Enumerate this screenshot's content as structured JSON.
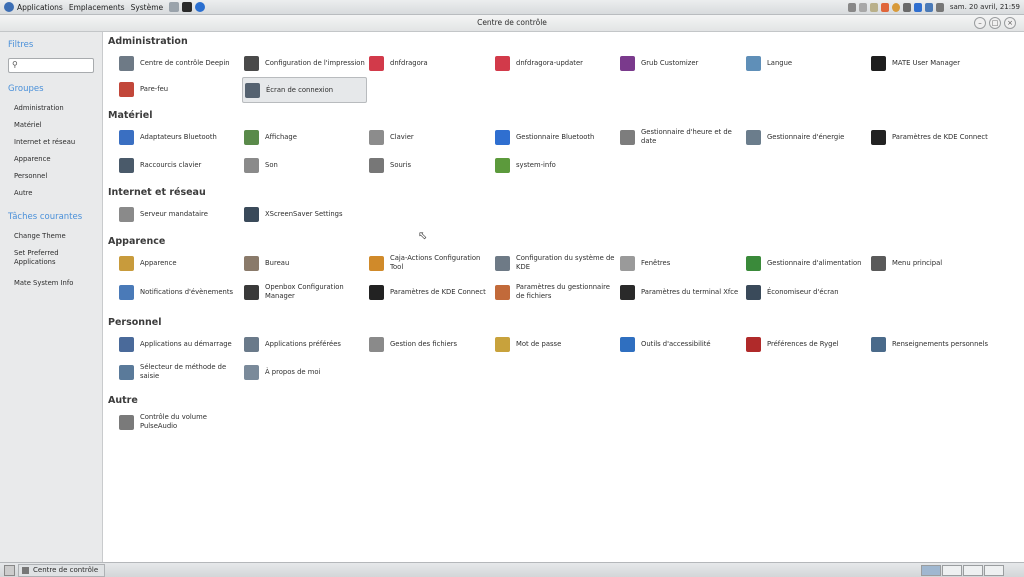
{
  "top_panel": {
    "menus": [
      "Applications",
      "Emplacements",
      "Système"
    ],
    "clock": "sam. 20 avril, 21:59"
  },
  "window": {
    "title": "Centre de contrôle"
  },
  "sidebar": {
    "filters_title": "Filtres",
    "search_value": "",
    "groups_title": "Groupes",
    "groups": [
      "Administration",
      "Matériel",
      "Internet et réseau",
      "Apparence",
      "Personnel",
      "Autre"
    ],
    "tasks_title": "Tâches courantes",
    "tasks": [
      "Change Theme",
      "Set Preferred Applications",
      "Mate System Info"
    ]
  },
  "sections": [
    {
      "title": "Administration",
      "items": [
        {
          "label": "Centre de contrôle Deepin",
          "icon": "tools-icon",
          "color": "#6e7a86"
        },
        {
          "label": "Configuration de l'impression",
          "icon": "printer-icon",
          "color": "#4a4a4a"
        },
        {
          "label": "dnfdragora",
          "icon": "dnfdragora-icon",
          "color": "#d23a4a"
        },
        {
          "label": "dnfdragora-updater",
          "icon": "dnfdragora-icon",
          "color": "#d23a4a"
        },
        {
          "label": "Grub Customizer",
          "icon": "grub-icon",
          "color": "#7a3a8c"
        },
        {
          "label": "Langue",
          "icon": "flag-icon",
          "color": "#5f8fb8"
        },
        {
          "label": "MATE User Manager",
          "icon": "users-icon",
          "color": "#1e1e1e"
        },
        {
          "label": "Pare-feu",
          "icon": "firewall-icon",
          "color": "#c2473a"
        },
        {
          "label": "Écran de connexion",
          "icon": "login-screen-icon",
          "color": "#556270",
          "selected": true
        }
      ]
    },
    {
      "title": "Matériel",
      "items": [
        {
          "label": "Adaptateurs Bluetooth",
          "icon": "bluetooth-adapter-icon",
          "color": "#3a6fc2"
        },
        {
          "label": "Affichage",
          "icon": "display-icon",
          "color": "#5a8a4a"
        },
        {
          "label": "Clavier",
          "icon": "keyboard-icon",
          "color": "#8c8c8c"
        },
        {
          "label": "Gestionnaire Bluetooth",
          "icon": "bluetooth-icon",
          "color": "#2f6fd0"
        },
        {
          "label": "Gestionnaire d'heure et de date",
          "icon": "clock-icon",
          "color": "#7d7d7d"
        },
        {
          "label": "Gestionnaire d'énergie",
          "icon": "power-icon",
          "color": "#6b7d8c"
        },
        {
          "label": "Paramètres de KDE Connect",
          "icon": "phone-icon",
          "color": "#222222"
        },
        {
          "label": "Raccourcis clavier",
          "icon": "keyboard-shortcuts-icon",
          "color": "#4a5a6a"
        },
        {
          "label": "Son",
          "icon": "speaker-icon",
          "color": "#8a8a8a"
        },
        {
          "label": "Souris",
          "icon": "mouse-icon",
          "color": "#777777"
        },
        {
          "label": "system-info",
          "icon": "system-info-icon",
          "color": "#5c9a3c"
        }
      ]
    },
    {
      "title": "Internet et réseau",
      "items": [
        {
          "label": "Serveur mandataire",
          "icon": "proxy-icon",
          "color": "#8a8a8a"
        },
        {
          "label": "XScreenSaver Settings",
          "icon": "screensaver-icon",
          "color": "#3a4a5a"
        }
      ]
    },
    {
      "title": "Apparence",
      "items": [
        {
          "label": "Apparence",
          "icon": "appearance-icon",
          "color": "#c89b3c"
        },
        {
          "label": "Bureau",
          "icon": "desktop-icon",
          "color": "#8a7a6a"
        },
        {
          "label": "Caja-Actions Configuration Tool",
          "icon": "caja-actions-icon",
          "color": "#d08a2a"
        },
        {
          "label": "Configuration du système de KDE",
          "icon": "kde-config-icon",
          "color": "#6e7a86"
        },
        {
          "label": "Fenêtres",
          "icon": "windows-icon",
          "color": "#9a9a9a"
        },
        {
          "label": "Gestionnaire d'alimentation",
          "icon": "battery-icon",
          "color": "#3a8a3a"
        },
        {
          "label": "Menu principal",
          "icon": "menu-icon",
          "color": "#5a5a5a"
        },
        {
          "label": "Notifications d'évènements",
          "icon": "notification-icon",
          "color": "#4a7ab8"
        },
        {
          "label": "Openbox Configuration Manager",
          "icon": "openbox-icon",
          "color": "#3a3a3a"
        },
        {
          "label": "Paramètres de KDE Connect",
          "icon": "phone-icon",
          "color": "#222222"
        },
        {
          "label": "Paramètres du gestionnaire de fichiers",
          "icon": "file-manager-settings-icon",
          "color": "#c26a3a"
        },
        {
          "label": "Paramètres du terminal Xfce",
          "icon": "terminal-icon",
          "color": "#2a2a2a"
        },
        {
          "label": "Économiseur d'écran",
          "icon": "screensaver-icon",
          "color": "#3a4a5a"
        }
      ]
    },
    {
      "title": "Personnel",
      "items": [
        {
          "label": "Applications au démarrage",
          "icon": "startup-icon",
          "color": "#4a6a9a"
        },
        {
          "label": "Applications préférées",
          "icon": "preferred-apps-icon",
          "color": "#6a7a8a"
        },
        {
          "label": "Gestion des fichiers",
          "icon": "file-management-icon",
          "color": "#8a8a8a"
        },
        {
          "label": "Mot de passe",
          "icon": "lock-icon",
          "color": "#c8a23c"
        },
        {
          "label": "Outils d'accessibilité",
          "icon": "accessibility-icon",
          "color": "#2f6fc0"
        },
        {
          "label": "Préférences de Rygel",
          "icon": "rygel-icon",
          "color": "#b02a2a"
        },
        {
          "label": "Renseignements personnels",
          "icon": "personal-info-icon",
          "color": "#4a6a8a"
        },
        {
          "label": "Sélecteur de méthode de saisie",
          "icon": "input-method-icon",
          "color": "#5a7a9a"
        },
        {
          "label": "À propos de moi",
          "icon": "about-me-icon",
          "color": "#7a8a9a"
        }
      ]
    },
    {
      "title": "Autre",
      "items": [
        {
          "label": "Contrôle du volume PulseAudio",
          "icon": "volume-icon",
          "color": "#7a7a7a"
        }
      ]
    }
  ],
  "bottom_panel": {
    "task_label": "Centre de contrôle",
    "workspaces": 4,
    "active_workspace": 1
  }
}
